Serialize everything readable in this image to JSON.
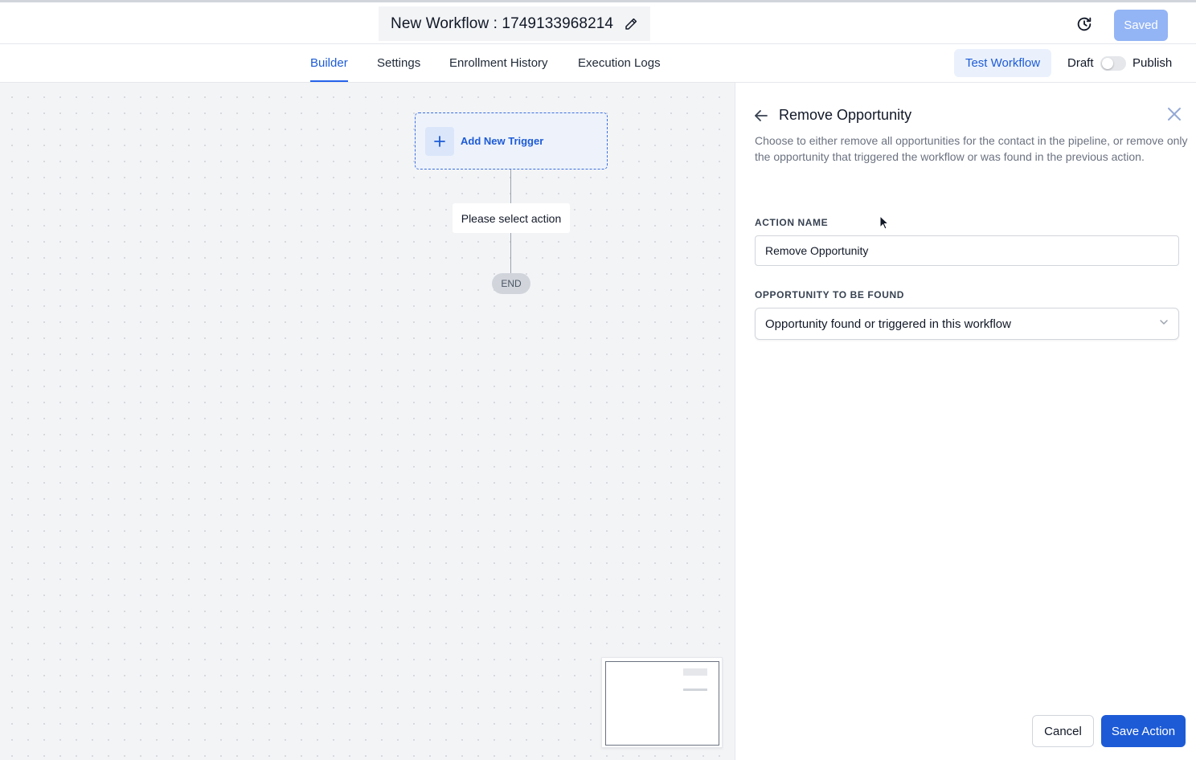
{
  "header": {
    "workflow_title": "New Workflow : 1749133968214",
    "saved_label": "Saved",
    "icons": {
      "edit": "pencil-icon",
      "history": "history-icon"
    }
  },
  "tabs": [
    {
      "label": "Builder",
      "active": true
    },
    {
      "label": "Settings",
      "active": false
    },
    {
      "label": "Enrollment History",
      "active": false
    },
    {
      "label": "Execution Logs",
      "active": false
    }
  ],
  "toolbar": {
    "test_label": "Test Workflow",
    "draft_label": "Draft",
    "publish_label": "Publish",
    "published": false
  },
  "canvas": {
    "trigger_label": "Add New Trigger",
    "action_placeholder": "Please select action",
    "end_label": "END"
  },
  "panel": {
    "title": "Remove Opportunity",
    "description": "Choose to either remove all opportunities for the contact in the pipeline, or remove only the opportunity that triggered the workflow or was found in the previous action.",
    "action_name_label": "ACTION NAME",
    "action_name_value": "Remove Opportunity",
    "opportunity_label": "OPPORTUNITY TO BE FOUND",
    "opportunity_value": "Opportunity found or triggered in this workflow",
    "cancel_label": "Cancel",
    "save_label": "Save Action"
  },
  "colors": {
    "accent": "#1d5bd6",
    "saved_button": "#93b4f5",
    "canvas_bg": "#f3f4f6"
  }
}
